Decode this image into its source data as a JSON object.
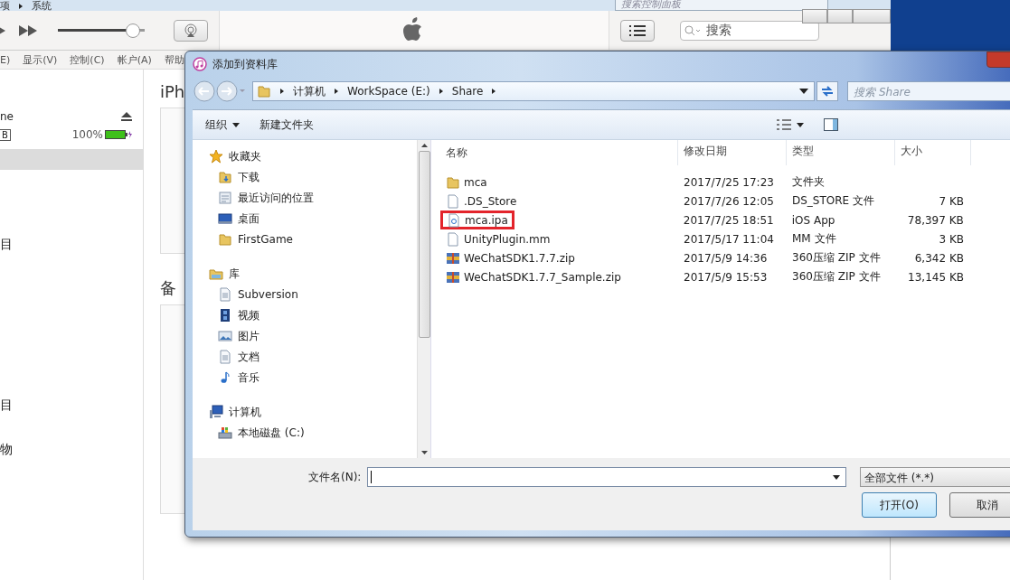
{
  "control_panel": {
    "breadcrumb": [
      "项",
      "系统"
    ],
    "search": {
      "placeholder": "搜索控制面板"
    }
  },
  "itunes": {
    "volume": {
      "level": 0.95
    },
    "search": {
      "placeholder": "搜索"
    },
    "menu": [
      "E)",
      "显示(V)",
      "控制(C)",
      "帐户(A)",
      "帮助"
    ],
    "device": {
      "name": "ne",
      "capacity": "B",
      "battery": "100%"
    },
    "sidebar": {
      "items": [
        {
          "selected": true
        },
        {
          "label": "目",
          "selected": false
        },
        {
          "label": "目",
          "selected": false
        },
        {
          "label": "物",
          "selected": false
        }
      ]
    },
    "main": {
      "title": "iPh",
      "section": "备"
    }
  },
  "dialog": {
    "title": "添加到资料库",
    "path": [
      "计算机",
      "WorkSpace (E:)",
      "Share"
    ],
    "search": {
      "placeholder": "搜索 Share"
    },
    "toolbar": {
      "organize": "组织",
      "new_folder": "新建文件夹"
    },
    "nav": [
      {
        "label": "收藏夹",
        "kind": "star",
        "children": [
          {
            "label": "下载",
            "kind": "download"
          },
          {
            "label": "最近访问的位置",
            "kind": "recent"
          },
          {
            "label": "桌面",
            "kind": "desktop"
          },
          {
            "label": "FirstGame",
            "kind": "folder"
          }
        ]
      },
      {
        "label": "库",
        "kind": "library",
        "children": [
          {
            "label": "Subversion",
            "kind": "doc"
          },
          {
            "label": "视频",
            "kind": "video"
          },
          {
            "label": "图片",
            "kind": "picture"
          },
          {
            "label": "文档",
            "kind": "doc"
          },
          {
            "label": "音乐",
            "kind": "music"
          }
        ]
      },
      {
        "label": "计算机",
        "kind": "computer",
        "children": [
          {
            "label": "本地磁盘 (C:)",
            "kind": "drive"
          }
        ]
      }
    ],
    "columns": [
      "名称",
      "修改日期",
      "类型",
      "大小"
    ],
    "files": [
      {
        "name": "mca",
        "date": "2017/7/25 17:23",
        "type": "文件夹",
        "kind": "folder",
        "highlighted": false
      },
      {
        "name": ".DS_Store",
        "date": "2017/7/26 12:05",
        "type": "DS_STORE 文件",
        "size": "7 KB",
        "kind": "file",
        "highlighted": false
      },
      {
        "name": "mca.ipa",
        "date": "2017/7/25 18:51",
        "type": "iOS App",
        "size": "78,397 KB",
        "kind": "app",
        "highlighted": true
      },
      {
        "name": "UnityPlugin.mm",
        "date": "2017/5/17 11:04",
        "type": "MM 文件",
        "size": "3 KB",
        "kind": "file",
        "highlighted": false
      },
      {
        "name": "WeChatSDK1.7.7.zip",
        "date": "2017/5/9 14:36",
        "type": "360压缩 ZIP 文件",
        "size": "6,342 KB",
        "kind": "zip",
        "highlighted": false
      },
      {
        "name": "WeChatSDK1.7.7_Sample.zip",
        "date": "2017/5/9 15:53",
        "type": "360压缩 ZIP 文件",
        "size": "13,145 KB",
        "kind": "zip",
        "highlighted": false
      }
    ],
    "file_name_label": "文件名(N):",
    "filter": "全部文件 (*.*)",
    "buttons": [
      {
        "label": "打开(O)",
        "kind": "default"
      },
      {
        "label": "取消",
        "kind": "normal"
      }
    ]
  }
}
